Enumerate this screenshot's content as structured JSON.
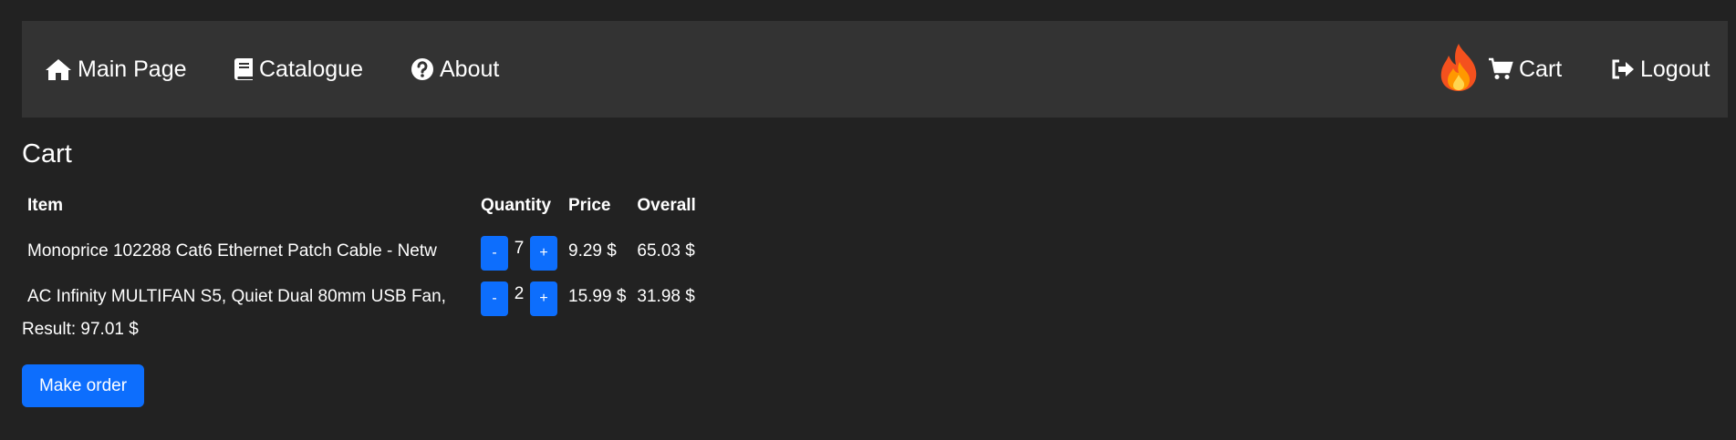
{
  "nav": {
    "main_label": "Main Page",
    "catalogue_label": "Catalogue",
    "about_label": "About",
    "cart_label": "Cart",
    "logout_label": "Logout",
    "icons": [
      "home-icon",
      "book-icon",
      "question-circle-icon",
      "fire-icon",
      "cart-icon",
      "logout-icon"
    ]
  },
  "page": {
    "title": "Cart"
  },
  "table": {
    "headers": [
      "Item",
      "Quantity",
      "Price",
      "Overall"
    ],
    "rows": [
      {
        "item": "Monoprice 102288 Cat6 Ethernet Patch Cable - Netw",
        "minus": "-",
        "quantity": "7",
        "plus": "+",
        "price": "9.29 $",
        "overall": "65.03 $"
      },
      {
        "item": "AC Infinity MULTIFAN S5, Quiet Dual 80mm USB Fan,",
        "minus": "-",
        "quantity": "2",
        "plus": "+",
        "price": "15.99 $",
        "overall": "31.98 $"
      }
    ]
  },
  "result": "Result: 97.01 $",
  "order_button": "Make order",
  "colors": {
    "background": "#222222",
    "navbar": "#333333",
    "accent": "#0d6efd",
    "text": "#ffffff"
  }
}
